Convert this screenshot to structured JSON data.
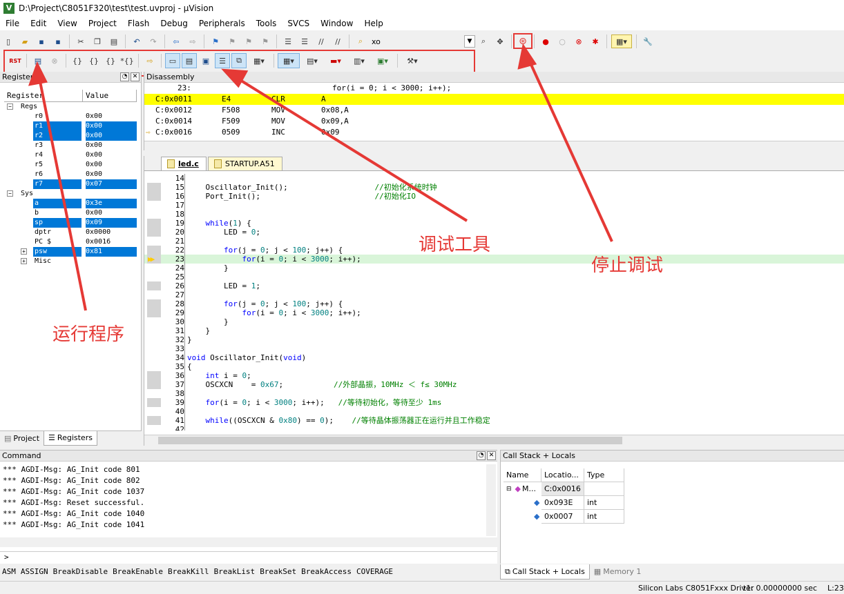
{
  "window": {
    "title": "D:\\Project\\C8051F320\\test\\test.uvproj - µVision",
    "icon_letter": "V"
  },
  "menu": [
    "File",
    "Edit",
    "View",
    "Project",
    "Flash",
    "Debug",
    "Peripherals",
    "Tools",
    "SVCS",
    "Window",
    "Help"
  ],
  "toolbar": {
    "search_value": "xo"
  },
  "registers": {
    "title": "Registers",
    "columns": [
      "Register",
      "Value"
    ],
    "group_regs": "Regs",
    "group_sys": "Sys",
    "rows": [
      {
        "name": "r0",
        "value": "0x00",
        "sel": false
      },
      {
        "name": "r1",
        "value": "0x00",
        "sel": true
      },
      {
        "name": "r2",
        "value": "0x00",
        "sel": true
      },
      {
        "name": "r3",
        "value": "0x00",
        "sel": false
      },
      {
        "name": "r4",
        "value": "0x00",
        "sel": false
      },
      {
        "name": "r5",
        "value": "0x00",
        "sel": false
      },
      {
        "name": "r6",
        "value": "0x00",
        "sel": false
      },
      {
        "name": "r7",
        "value": "0x07",
        "sel": true
      }
    ],
    "sys_rows": [
      {
        "name": "a",
        "value": "0x3e",
        "sel": true
      },
      {
        "name": "b",
        "value": "0x00",
        "sel": false
      },
      {
        "name": "sp",
        "value": "0x09",
        "sel": true
      },
      {
        "name": "dptr",
        "value": "0x0000",
        "sel": false
      },
      {
        "name": "PC  $",
        "value": "0x0016",
        "sel": false
      },
      {
        "name": "psw",
        "value": "0x81",
        "sel": true
      }
    ],
    "misc": "Misc"
  },
  "left_tabs": [
    "Project",
    "Registers"
  ],
  "disassembly": {
    "title": "Disassembly",
    "source_line": {
      "num": "23:",
      "code": "for(i = 0; i < 3000; i++);"
    },
    "rows": [
      {
        "addr": "C:0x0011",
        "hex": "E4",
        "op": "CLR",
        "arg": "A"
      },
      {
        "addr": "C:0x0012",
        "hex": "F508",
        "op": "MOV",
        "arg": "0x08,A"
      },
      {
        "addr": "C:0x0014",
        "hex": "F509",
        "op": "MOV",
        "arg": "0x09,A"
      },
      {
        "addr": "C:0x0016",
        "hex": "0509",
        "op": "INC",
        "arg": "0x09"
      }
    ]
  },
  "editor": {
    "tabs": [
      "led.c",
      "STARTUP.A51"
    ],
    "lines": [
      {
        "n": "14",
        "t": ""
      },
      {
        "n": "15",
        "t": "    Oscillator_Init();                   <c>//初始化系统时钟</c>"
      },
      {
        "n": "16",
        "t": "    Port_Init();                         <c>//初始化IO</c>"
      },
      {
        "n": "17",
        "t": ""
      },
      {
        "n": "18",
        "t": ""
      },
      {
        "n": "19",
        "t": "    <k>while</k>(<d>1</d>) {"
      },
      {
        "n": "20",
        "t": "        LED = <d>0</d>;"
      },
      {
        "n": "21",
        "t": ""
      },
      {
        "n": "22",
        "t": "        <k>for</k>(j = <d>0</d>; j < <d>100</d>; j++) {"
      },
      {
        "n": "23",
        "t": "            <k>for</k>(i = <d>0</d>; i < <d>3000</d>; i++);"
      },
      {
        "n": "24",
        "t": "        }"
      },
      {
        "n": "25",
        "t": ""
      },
      {
        "n": "26",
        "t": "        LED = <d>1</d>;"
      },
      {
        "n": "27",
        "t": ""
      },
      {
        "n": "28",
        "t": "        <k>for</k>(j = <d>0</d>; j < <d>100</d>; j++) {"
      },
      {
        "n": "29",
        "t": "            <k>for</k>(i = <d>0</d>; i < <d>3000</d>; i++);"
      },
      {
        "n": "30",
        "t": "        }"
      },
      {
        "n": "31",
        "t": "    }"
      },
      {
        "n": "32",
        "t": "}"
      },
      {
        "n": "33",
        "t": ""
      },
      {
        "n": "34",
        "t": "<k>void</k> Oscillator_Init(<k>void</k>)"
      },
      {
        "n": "35",
        "t": "{"
      },
      {
        "n": "36",
        "t": "    <k>int</k> i = <d>0</d>;"
      },
      {
        "n": "37",
        "t": "    OSCXCN    = <d>0x67</d>;           <c>//外部晶振，10MHz ＜ f≤ 30MHz</c>"
      },
      {
        "n": "38",
        "t": ""
      },
      {
        "n": "39",
        "t": "    <k>for</k>(i = <d>0</d>; i < <d>3000</d>; i++);   <c>//等待初始化，等待至少 1ms</c>"
      },
      {
        "n": "40",
        "t": ""
      },
      {
        "n": "41",
        "t": "    <k>while</k>((OSCXCN & <d>0x80</d>) == <d>0</d>);    <c>//等待晶体振荡器正在运行并且工作稳定</c>"
      },
      {
        "n": "42",
        "t": ""
      }
    ]
  },
  "command": {
    "title": "Command",
    "lines": [
      "*** AGDI-Msg: AG_Init code 801",
      "*** AGDI-Msg: AG_Init code 802",
      "*** AGDI-Msg: AG_Init code 1037",
      "*** AGDI-Msg: Reset successful.",
      "*** AGDI-Msg: AG_Init code 1040",
      "*** AGDI-Msg: AG_Init code 1041"
    ],
    "prompt": ">",
    "keywords": [
      "ASM",
      "ASSIGN",
      "BreakDisable",
      "BreakEnable",
      "BreakKill",
      "BreakList",
      "BreakSet",
      "BreakAccess",
      "COVERAGE"
    ]
  },
  "callstack": {
    "title": "Call Stack + Locals",
    "columns": [
      "Name",
      "Locatio...",
      "Type"
    ],
    "rows": [
      {
        "name": "M...",
        "loc": "C:0x0016",
        "type": ""
      },
      {
        "name": "",
        "loc": "0x093E",
        "type": "int"
      },
      {
        "name": "",
        "loc": "0x0007",
        "type": "int"
      }
    ],
    "tabs": [
      "Call Stack + Locals",
      "Memory 1"
    ]
  },
  "status": {
    "driver": "Silicon Labs C8051Fxxx Driver",
    "time": "t1: 0.00000000 sec",
    "line": "L:23"
  },
  "annotations": {
    "run": "运行程序",
    "debug_tools": "调试工具",
    "stop_debug": "停止调试"
  },
  "colors": {
    "accent": "#e53935",
    "selection": "#0078d7",
    "current_line": "#ffff00"
  }
}
